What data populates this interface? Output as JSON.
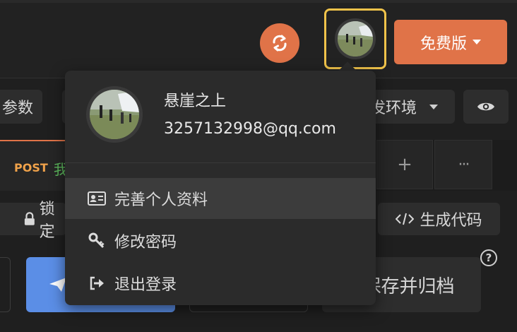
{
  "header": {
    "sync_icon": "sync-icon",
    "plan_button": {
      "label": "免费版"
    }
  },
  "toolbar": {
    "params_label": "参数",
    "env_label": "发环境",
    "eye_icon": "eye-icon"
  },
  "tabs": {
    "active": {
      "method": "POST",
      "name": "我"
    },
    "add_label": "+",
    "more_label": "···"
  },
  "actions": {
    "lock_label": "锁定",
    "generate_code_label": "生成代码",
    "save_archive_label": "保存并归档",
    "help_label": "?"
  },
  "user_menu": {
    "username": "悬崖之上",
    "email": "3257132998@qq.com",
    "items": [
      {
        "label": "完善个人资料",
        "icon": "id-card-icon"
      },
      {
        "label": "修改密码",
        "icon": "key-icon"
      },
      {
        "label": "退出登录",
        "icon": "logout-icon"
      }
    ]
  },
  "colors": {
    "accent": "#e07348",
    "highlight_border": "#f0c34a",
    "send_button": "#5b8ee6",
    "post_method": "#f0a24a",
    "tab_name": "#5cb85c",
    "menu_bg": "#2b2b2b",
    "menu_hover": "#3c3c3c"
  }
}
